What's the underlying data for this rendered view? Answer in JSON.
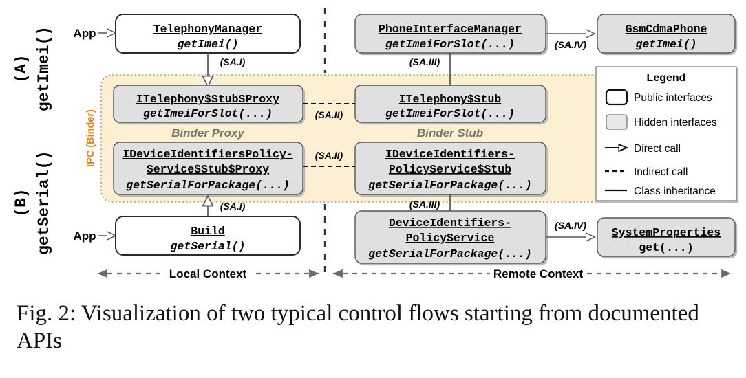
{
  "figure": {
    "caption": "Fig. 2: Visualization of two typical control flows starting from documented APIs",
    "ipc_band_label": "IPC (Binder)",
    "ipc_band_color": "#fdf0d2",
    "ipc_border_color": "#c8a96a",
    "ipc_label_color": "#e3820d",
    "public_fill": "#ffffff",
    "hidden_fill": "#e0e0e0",
    "band_text_color": "#7a7468"
  },
  "rows": [
    {
      "id": "A",
      "marker": "(A)",
      "api": "getImei()"
    },
    {
      "id": "B",
      "marker": "(B)",
      "api": "getSerial()"
    }
  ],
  "entry_points": [
    {
      "label": "App"
    },
    {
      "label": "App"
    }
  ],
  "boxes": {
    "telephony_manager": {
      "title": "TelephonyManager",
      "method": "getImei()",
      "kind": "public"
    },
    "phone_interface_manager": {
      "title": "PhoneInterfaceManager",
      "method": "getImeiForSlot(...)",
      "kind": "hidden"
    },
    "gsm_cdma_phone": {
      "title": "GsmCdmaPhone",
      "method": "getImei()",
      "kind": "hidden"
    },
    "itelephony_stub_proxy": {
      "title": "ITelephony$Stub$Proxy",
      "method": "getImeiForSlot(...)",
      "kind": "hidden"
    },
    "itelephony_stub": {
      "title": "ITelephony$Stub",
      "method": "getImeiForSlot(...)",
      "kind": "hidden"
    },
    "idevice_policy_stub_proxy": {
      "title_line1": "IDeviceIdentifiersPolicy-",
      "title_line2": "Service$Stub$Proxy",
      "method": "getSerialForPackage(...)",
      "kind": "hidden"
    },
    "idevice_policy_stub": {
      "title_line1": "IDeviceIdentifiers-",
      "title_line2": "PolicyService$Stub",
      "method": "getSerialForPackage(...)",
      "kind": "hidden"
    },
    "build": {
      "title": "Build",
      "method": "getSerial()",
      "kind": "public"
    },
    "device_policy_service": {
      "title_line1": "DeviceIdentifiers-",
      "title_line2": "PolicyService",
      "method": "getSerialForPackage(...)",
      "kind": "hidden"
    },
    "system_properties": {
      "title": "SystemProperties",
      "method": "get(...)",
      "kind": "hidden",
      "method_italic": false
    }
  },
  "band_labels": {
    "proxy": "Binder Proxy",
    "stub": "Binder Stub"
  },
  "edges": [
    {
      "id": "tm-to-proxy",
      "label": "(SA.I)",
      "type": "inheritance"
    },
    {
      "id": "proxy-to-stub-imei",
      "label": "(SA.II)",
      "type": "indirect"
    },
    {
      "id": "stub-to-pim",
      "label": "(SA.III)",
      "type": "inheritance"
    },
    {
      "id": "pim-to-gsm",
      "label": "(SA.IV)",
      "type": "direct"
    },
    {
      "id": "build-to-proxy",
      "label": "(SA.I)",
      "type": "inheritance"
    },
    {
      "id": "proxy-to-stub-serial",
      "label": "(SA.II)",
      "type": "indirect"
    },
    {
      "id": "stub-to-dips",
      "label": "(SA.III)",
      "type": "inheritance"
    },
    {
      "id": "dips-to-sysprops",
      "label": "(SA.IV)",
      "type": "direct"
    }
  ],
  "contexts": [
    {
      "label": "Local Context"
    },
    {
      "label": "Remote Context"
    }
  ],
  "legend": {
    "title": "Legend",
    "items": [
      {
        "label": "Public interfaces",
        "glyph": "public-box-icon"
      },
      {
        "label": "Hidden interfaces",
        "glyph": "hidden-box-icon"
      },
      {
        "label": "Direct call",
        "glyph": "arrow-icon"
      },
      {
        "label": "Indirect call",
        "glyph": "dashed-line-icon"
      },
      {
        "label": "Class inheritance",
        "glyph": "solid-line-icon"
      }
    ]
  }
}
